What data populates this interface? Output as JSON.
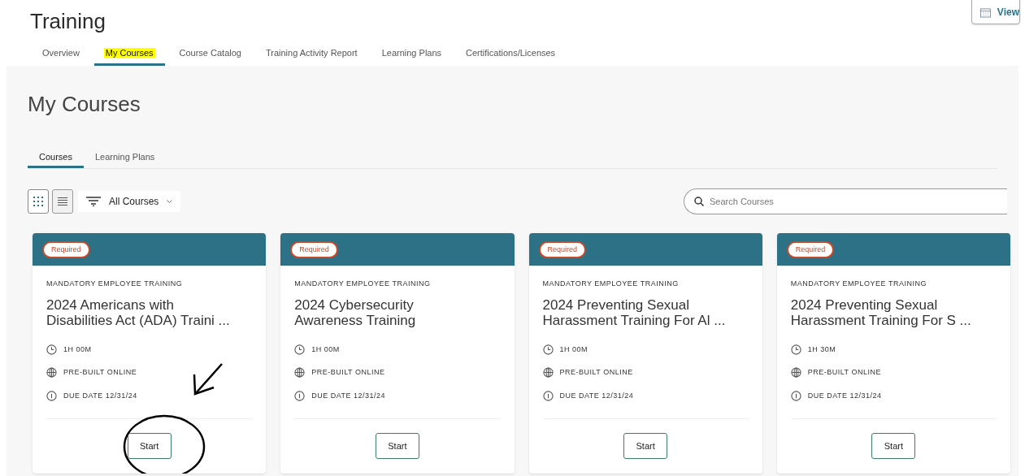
{
  "header": {
    "title": "Training",
    "view_button": "View"
  },
  "tabs": [
    {
      "label": "Overview",
      "selected": false,
      "highlighted": false
    },
    {
      "label": "My Courses",
      "selected": true,
      "highlighted": true
    },
    {
      "label": "Course Catalog",
      "selected": false,
      "highlighted": false
    },
    {
      "label": "Training Activity Report",
      "selected": false,
      "highlighted": false
    },
    {
      "label": "Learning Plans",
      "selected": false,
      "highlighted": false
    },
    {
      "label": "Certifications/Licenses",
      "selected": false,
      "highlighted": false
    }
  ],
  "page": {
    "title": "My Courses",
    "subtabs": [
      {
        "label": "Courses",
        "selected": true
      },
      {
        "label": "Learning Plans",
        "selected": false
      }
    ],
    "toolbar": {
      "views": [
        {
          "kind": "grid",
          "selected": true
        },
        {
          "kind": "list",
          "selected": false
        }
      ],
      "filter": "All Courses",
      "search": {
        "placeholder": "Search Courses"
      }
    },
    "courses": [
      {
        "badge": "Required",
        "category": "MANDATORY EMPLOYEE TRAINING",
        "title_lines": [
          "2024 Americans with",
          "Disabilities Act (ADA) Traini ..."
        ],
        "duration": "1H 00M",
        "format": "PRE-BUILT ONLINE",
        "due": "DUE DATE 12/31/24",
        "button": "Start",
        "annotated": true
      },
      {
        "badge": "Required",
        "category": "MANDATORY EMPLOYEE TRAINING",
        "title_lines": [
          "2024 Cybersecurity",
          "Awareness Training"
        ],
        "duration": "1H 00M",
        "format": "PRE-BUILT ONLINE",
        "due": "DUE DATE 12/31/24",
        "button": "Start",
        "annotated": false
      },
      {
        "badge": "Required",
        "category": "MANDATORY EMPLOYEE TRAINING",
        "title_lines": [
          "2024 Preventing Sexual",
          "Harassment Training For Al ..."
        ],
        "duration": "1H 00M",
        "format": "PRE-BUILT ONLINE",
        "due": "DUE DATE 12/31/24",
        "button": "Start",
        "annotated": false
      },
      {
        "badge": "Required",
        "category": "MANDATORY EMPLOYEE TRAINING",
        "title_lines": [
          "2024 Preventing Sexual",
          "Harassment Training For S ..."
        ],
        "duration": "1H 30M",
        "format": "PRE-BUILT ONLINE",
        "due": "DUE DATE 12/31/24",
        "button": "Start",
        "annotated": false
      }
    ]
  }
}
